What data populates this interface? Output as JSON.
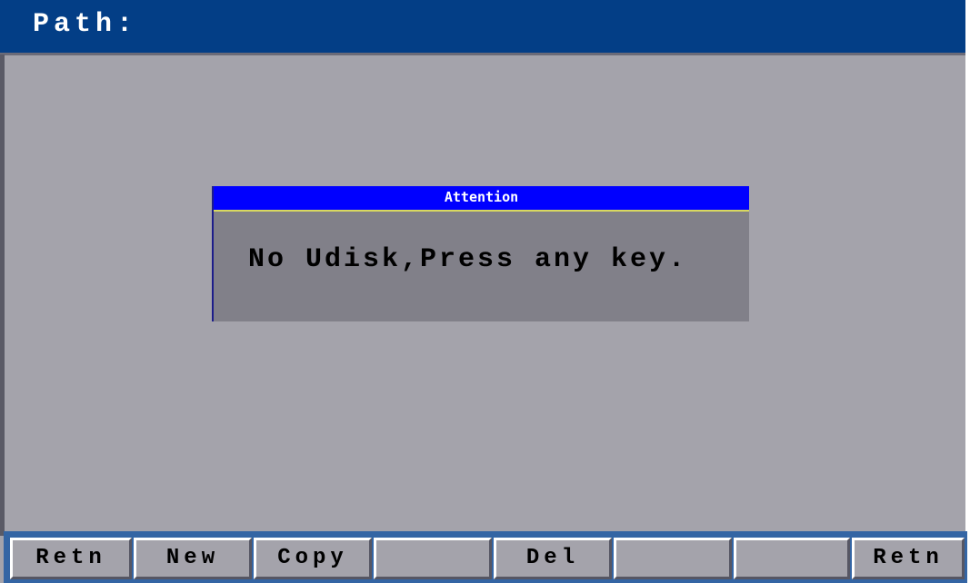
{
  "header": {
    "title": "Path:"
  },
  "dialog": {
    "title": "Attention",
    "message": "No Udisk,Press any key."
  },
  "softkeys": [
    {
      "label": "Retn"
    },
    {
      "label": "New"
    },
    {
      "label": "Copy"
    },
    {
      "label": ""
    },
    {
      "label": "Del"
    },
    {
      "label": ""
    },
    {
      "label": ""
    },
    {
      "label": "Retn"
    }
  ],
  "colors": {
    "header_bg": "#033e86",
    "screen_bg": "#a4a3ab",
    "dialog_bg": "#818089",
    "dialog_title_bg": "#0000ff",
    "footer_bg": "#3465a4"
  }
}
